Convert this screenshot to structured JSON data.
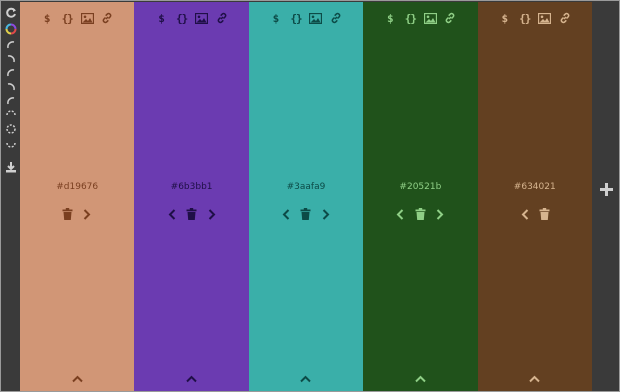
{
  "colors": {
    "toolbar_bg": "#3a3a3a",
    "toolbar_icon": "#cfcfcf"
  },
  "toolbar": {
    "icons": [
      "refresh-icon",
      "color-wheel-icon",
      "arc-icon",
      "arc-icon",
      "arc-icon",
      "arc-icon",
      "arc-icon",
      "arc-icon",
      "arc-icon",
      "arc-icon",
      "download-icon"
    ]
  },
  "columns": [
    {
      "hex": "#d19676",
      "bg": "#d19676",
      "fg": "#7a3f20",
      "has_left_arrow": false,
      "has_right_arrow": true
    },
    {
      "hex": "#6b3bb1",
      "bg": "#6b3bb1",
      "fg": "#1f0f47",
      "has_left_arrow": true,
      "has_right_arrow": true
    },
    {
      "hex": "#3aafa9",
      "bg": "#3aafa9",
      "fg": "#0c4b47",
      "has_left_arrow": true,
      "has_right_arrow": true
    },
    {
      "hex": "#20521b",
      "bg": "#20521b",
      "fg": "#8fcf86",
      "has_left_arrow": true,
      "has_right_arrow": true
    },
    {
      "hex": "#634021",
      "bg": "#634021",
      "fg": "#d6b48f",
      "has_left_arrow": true,
      "has_right_arrow": false
    }
  ],
  "top_icons": [
    "dollar-icon",
    "braces-icon",
    "image-icon",
    "link-icon"
  ],
  "top_icon_text": {
    "dollar": "$",
    "braces": "{}"
  },
  "add_button_icon": "plus-icon"
}
